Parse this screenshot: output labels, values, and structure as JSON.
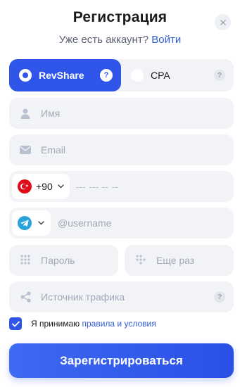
{
  "header": {
    "title": "Регистрация",
    "subtitle_prefix": "Уже есть аккаунт?",
    "login_link": "Войти",
    "close_icon": "close-icon"
  },
  "plan": {
    "options": [
      {
        "label": "RevShare",
        "selected": true,
        "help": "?"
      },
      {
        "label": "CPA",
        "selected": false,
        "help": "?"
      }
    ],
    "accent_color": "#2f56e8"
  },
  "form": {
    "name_placeholder": "Имя",
    "email_placeholder": "Email",
    "phone": {
      "country_code": "+90",
      "country_flag": "turkey-flag-icon",
      "placeholder": "--- --- -- --"
    },
    "messenger": {
      "icon": "telegram-icon",
      "placeholder": "@username"
    },
    "password_placeholder": "Пароль",
    "password_repeat_placeholder": "Еще раз",
    "traffic_source_placeholder": "Источник трафика",
    "traffic_help": "?"
  },
  "agreement": {
    "checked": true,
    "text": "Я принимаю",
    "link": "правила и условия"
  },
  "submit_label": "Зарегистрироваться"
}
